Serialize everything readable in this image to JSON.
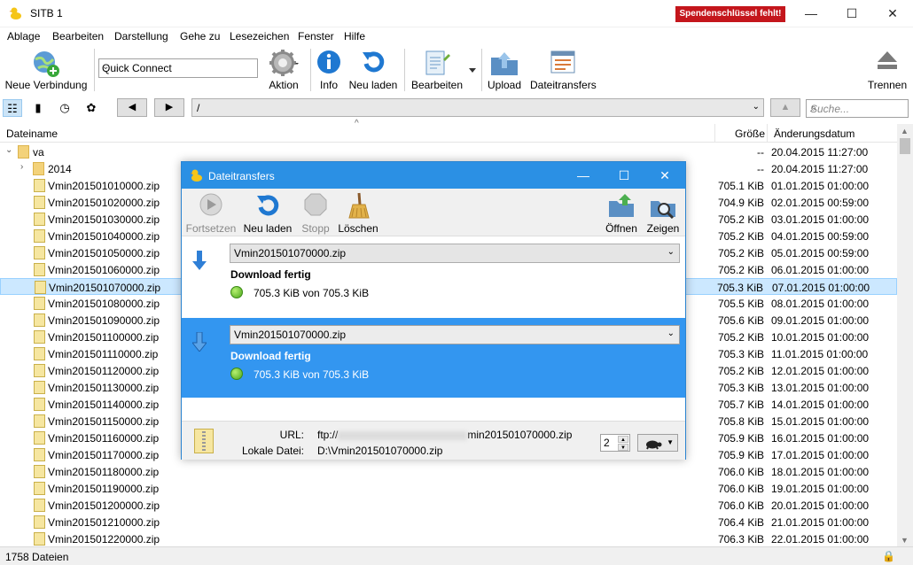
{
  "window": {
    "title": "SITB 1",
    "donate_label": "Spendenschlüssel fehlt!",
    "minimize": "—",
    "maximize": "☐",
    "close": "✕"
  },
  "menu": [
    "Ablage",
    "Bearbeiten",
    "Darstellung",
    "Gehe zu",
    "Lesezeichen",
    "Fenster",
    "Hilfe"
  ],
  "toolbar": {
    "new_connection": "Neue Verbindung",
    "quick_connect": "Quick Connect",
    "action": "Aktion",
    "info": "Info",
    "reload": "Neu laden",
    "edit": "Bearbeiten",
    "upload": "Upload",
    "transfers": "Dateitransfers",
    "disconnect": "Trennen"
  },
  "navbar": {
    "path": "/",
    "search_placeholder": "Suche..."
  },
  "columns": {
    "name": "Dateiname",
    "size": "Größe",
    "modified": "Änderungsdatum"
  },
  "files": [
    {
      "name": "va",
      "size": "--",
      "date": "20.04.2015 11:27:00",
      "kind": "folder",
      "level": 0,
      "expander": "⌄"
    },
    {
      "name": "2014",
      "size": "--",
      "date": "20.04.2015 11:27:00",
      "kind": "folder",
      "level": 1,
      "expander": "›"
    },
    {
      "name": "Vmin201501010000.zip",
      "size": "705.1 KiB",
      "date": "01.01.2015 01:00:00",
      "kind": "zip",
      "level": 1
    },
    {
      "name": "Vmin201501020000.zip",
      "size": "704.9 KiB",
      "date": "02.01.2015 00:59:00",
      "kind": "zip",
      "level": 1
    },
    {
      "name": "Vmin201501030000.zip",
      "size": "705.2 KiB",
      "date": "03.01.2015 01:00:00",
      "kind": "zip",
      "level": 1
    },
    {
      "name": "Vmin201501040000.zip",
      "size": "705.2 KiB",
      "date": "04.01.2015 00:59:00",
      "kind": "zip",
      "level": 1
    },
    {
      "name": "Vmin201501050000.zip",
      "size": "705.2 KiB",
      "date": "05.01.2015 00:59:00",
      "kind": "zip",
      "level": 1
    },
    {
      "name": "Vmin201501060000.zip",
      "size": "705.2 KiB",
      "date": "06.01.2015 01:00:00",
      "kind": "zip",
      "level": 1
    },
    {
      "name": "Vmin201501070000.zip",
      "size": "705.3 KiB",
      "date": "07.01.2015 01:00:00",
      "kind": "zip",
      "level": 1,
      "selected": true
    },
    {
      "name": "Vmin201501080000.zip",
      "size": "705.5 KiB",
      "date": "08.01.2015 01:00:00",
      "kind": "zip",
      "level": 1
    },
    {
      "name": "Vmin201501090000.zip",
      "size": "705.6 KiB",
      "date": "09.01.2015 01:00:00",
      "kind": "zip",
      "level": 1
    },
    {
      "name": "Vmin201501100000.zip",
      "size": "705.2 KiB",
      "date": "10.01.2015 01:00:00",
      "kind": "zip",
      "level": 1
    },
    {
      "name": "Vmin201501110000.zip",
      "size": "705.3 KiB",
      "date": "11.01.2015 01:00:00",
      "kind": "zip",
      "level": 1
    },
    {
      "name": "Vmin201501120000.zip",
      "size": "705.2 KiB",
      "date": "12.01.2015 01:00:00",
      "kind": "zip",
      "level": 1
    },
    {
      "name": "Vmin201501130000.zip",
      "size": "705.3 KiB",
      "date": "13.01.2015 01:00:00",
      "kind": "zip",
      "level": 1
    },
    {
      "name": "Vmin201501140000.zip",
      "size": "705.7 KiB",
      "date": "14.01.2015 01:00:00",
      "kind": "zip",
      "level": 1
    },
    {
      "name": "Vmin201501150000.zip",
      "size": "705.8 KiB",
      "date": "15.01.2015 01:00:00",
      "kind": "zip",
      "level": 1
    },
    {
      "name": "Vmin201501160000.zip",
      "size": "705.9 KiB",
      "date": "16.01.2015 01:00:00",
      "kind": "zip",
      "level": 1
    },
    {
      "name": "Vmin201501170000.zip",
      "size": "705.9 KiB",
      "date": "17.01.2015 01:00:00",
      "kind": "zip",
      "level": 1
    },
    {
      "name": "Vmin201501180000.zip",
      "size": "706.0 KiB",
      "date": "18.01.2015 01:00:00",
      "kind": "zip",
      "level": 1
    },
    {
      "name": "Vmin201501190000.zip",
      "size": "706.0 KiB",
      "date": "19.01.2015 01:00:00",
      "kind": "zip",
      "level": 1
    },
    {
      "name": "Vmin201501200000.zip",
      "size": "706.0 KiB",
      "date": "20.01.2015 01:00:00",
      "kind": "zip",
      "level": 1
    },
    {
      "name": "Vmin201501210000.zip",
      "size": "706.4 KiB",
      "date": "21.01.2015 01:00:00",
      "kind": "zip",
      "level": 1
    },
    {
      "name": "Vmin201501220000.zip",
      "size": "706.3 KiB",
      "date": "22.01.2015 01:00:00",
      "kind": "zip",
      "level": 1
    }
  ],
  "status": {
    "count": "1758 Dateien"
  },
  "dialog": {
    "title": "Dateitransfers",
    "minimize": "—",
    "maximize": "☐",
    "close": "✕",
    "toolbar": {
      "resume": "Fortsetzen",
      "reload": "Neu laden",
      "stop": "Stopp",
      "clear": "Löschen",
      "open": "Öffnen",
      "show": "Zeigen"
    },
    "transfers": [
      {
        "file": "Vmin201501070000.zip",
        "status": "Download fertig",
        "progress": "705.3 KiB von 705.3 KiB"
      },
      {
        "file": "Vmin201501070000.zip",
        "status": "Download fertig",
        "progress": "705.3 KiB von 705.3 KiB",
        "selected": true
      }
    ],
    "details": {
      "url_label": "URL:",
      "url_prefix": "ftp://",
      "url_suffix": "min201501070000.zip",
      "local_label": "Lokale Datei:",
      "local_value": "D:\\Vmin201501070000.zip",
      "connections": "2"
    }
  },
  "colors": {
    "accent": "#2b90e4",
    "selection": "#3396f0",
    "donate": "#c4161c",
    "row_selected": "#cce8ff"
  }
}
